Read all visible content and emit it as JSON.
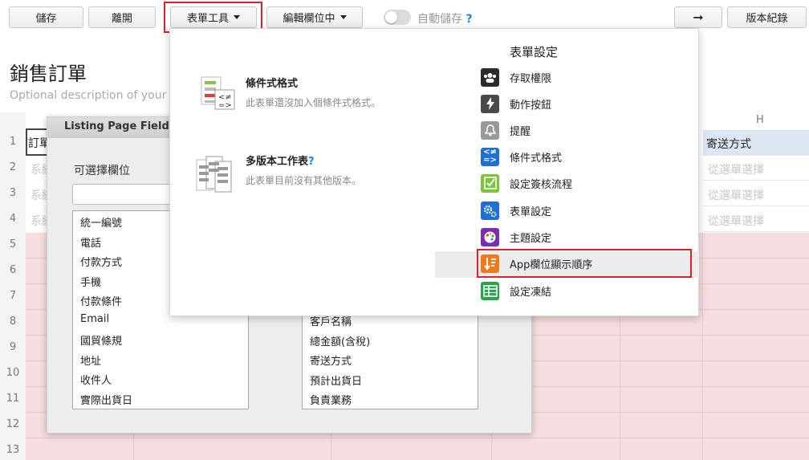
{
  "toolbar": {
    "save": "儲存",
    "leave": "離開",
    "form_tools": "表單工具",
    "editing_field": "編輯欄位中",
    "autosave": "自動儲存",
    "help": "?",
    "arrow": "➞",
    "version_history": "版本紀錄"
  },
  "page": {
    "title": "銷售訂單",
    "description": "Optional description of your fo"
  },
  "grid": {
    "row_numbers": [
      "1",
      "2",
      "3",
      "4",
      "5",
      "6",
      "7",
      "8",
      "9",
      "10",
      "11",
      "12",
      "13"
    ],
    "col_h": "H",
    "header_left": "訂單",
    "header_right": "寄送方式",
    "left_cells": [
      "系統",
      "系統",
      "系統"
    ],
    "right_cells": [
      "從選單選擇",
      "從選單選擇",
      "從選單選擇"
    ]
  },
  "dialog": {
    "title": "Listing Page Field Pic",
    "available_label": "可選擇欄位",
    "available_fields": [
      "統一編號",
      "電話",
      "付款方式",
      "手機",
      "付款條件",
      "Email",
      "國貿條規",
      "地址",
      "收件人",
      "實際出貨日"
    ],
    "selected_fields": [
      "客戶名稱",
      "總金額(含稅)",
      "寄送方式",
      "預計出貨日",
      "負責業務"
    ]
  },
  "menu": {
    "conditional_title": "條件式格式",
    "conditional_sub": "此表單還沒加入個條件式格式。",
    "multiversion_title": "多版本工作表",
    "multiversion_help": "?",
    "multiversion_sub": "此表單目前沒有其他版本。",
    "settings_title": "表單設定",
    "settings_items": [
      {
        "label": "存取權限",
        "icon": "users-icon",
        "color": "#2b2b2b"
      },
      {
        "label": "動作按鈕",
        "icon": "lightning-icon",
        "color": "#4a4a4a"
      },
      {
        "label": "提醒",
        "icon": "bell-icon",
        "color": "#9a9a9a"
      },
      {
        "label": "條件式格式",
        "icon": "conditional-format-icon",
        "color": "#1f6fd6"
      },
      {
        "label": "設定簽核流程",
        "icon": "approval-check-icon",
        "color": "#7cc43a"
      },
      {
        "label": "表單設定",
        "icon": "gears-icon",
        "color": "#1f6fd6"
      },
      {
        "label": "主題設定",
        "icon": "palette-icon",
        "color": "#7b2fb0"
      },
      {
        "label": "App欄位顯示順序",
        "icon": "sort-order-icon",
        "color": "#f07a1a"
      },
      {
        "label": "設定凍結",
        "icon": "freeze-table-icon",
        "color": "#2aa34a"
      }
    ]
  },
  "colors": {
    "highlight_red": "#e0202a",
    "grid_pink": "#f6dde0",
    "header_blue": "#dde6f3"
  }
}
